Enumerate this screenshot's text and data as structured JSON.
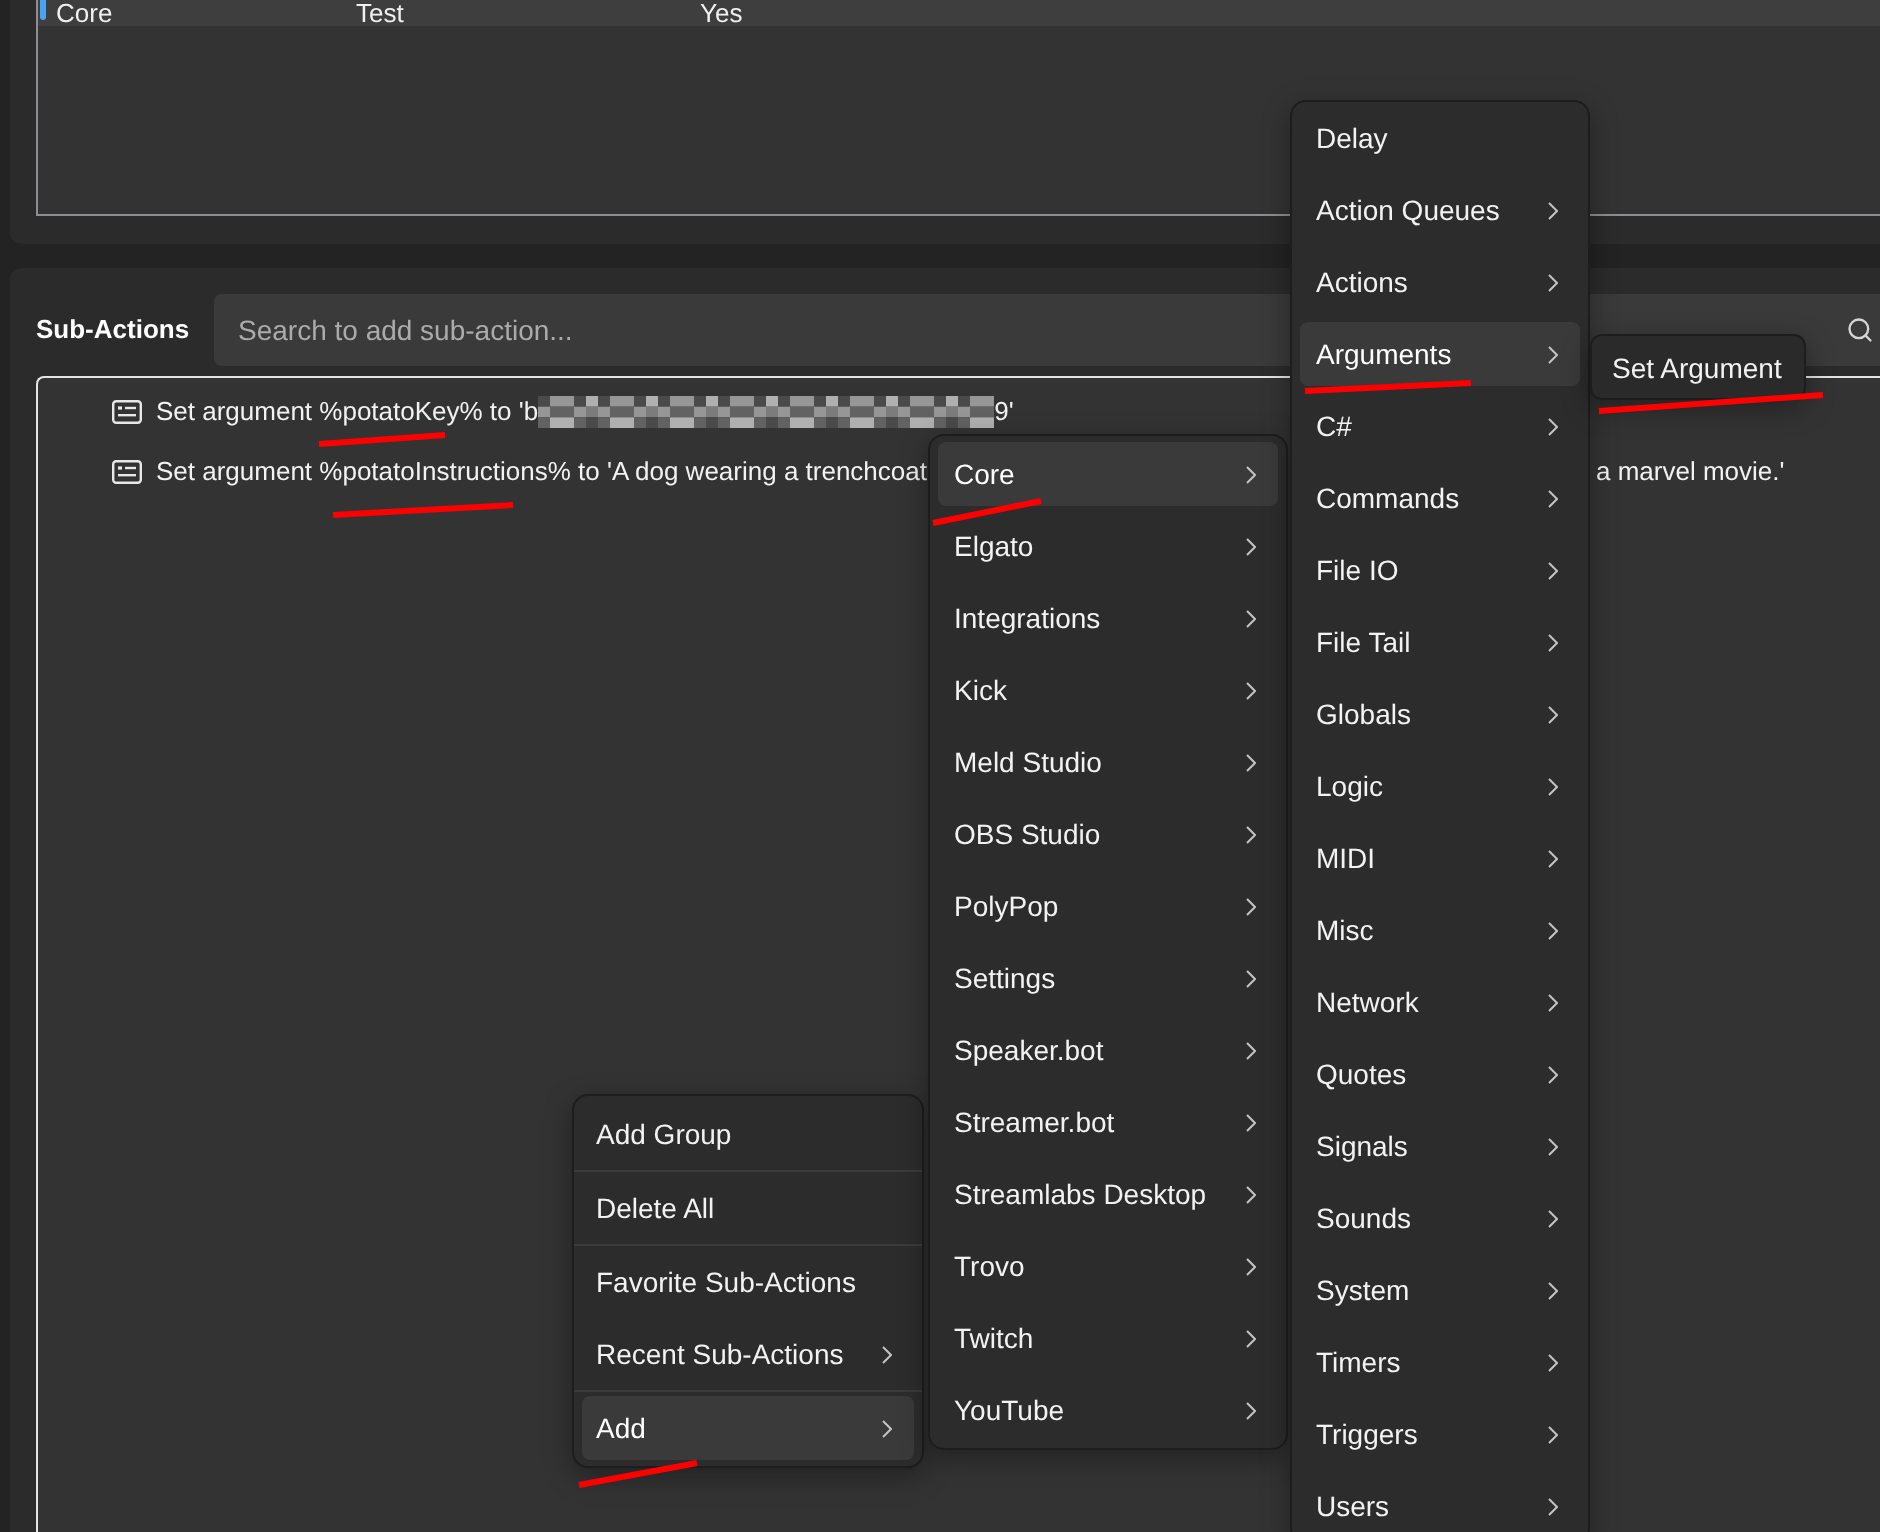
{
  "table": {
    "rows": [
      {
        "cells": [
          "Core",
          "Test",
          "Yes"
        ],
        "selected": true
      }
    ]
  },
  "sub_actions": {
    "label": "Sub-Actions",
    "search": {
      "placeholder": "Search to add sub-action..."
    },
    "items": [
      {
        "kind": "redacted",
        "text": "Set argument %potatoKey% to 'b",
        "text_end": "9'",
        "underlined": true
      },
      {
        "kind": "overlapped",
        "text": "Set argument %potatoInstructions% to 'A dog wearing a trenchcoat",
        "text_end": "a marvel movie.'",
        "underlined": true
      }
    ]
  },
  "context_menu": {
    "groups": [
      {
        "items": [
          {
            "label": "Add Group",
            "submenu": false,
            "selected": false,
            "underlined": false
          }
        ]
      },
      {
        "items": [
          {
            "label": "Delete All",
            "submenu": false,
            "selected": false,
            "underlined": false
          }
        ]
      },
      {
        "items": [
          {
            "label": "Favorite Sub-Actions",
            "submenu": false,
            "selected": false,
            "underlined": false
          },
          {
            "label": "Recent Sub-Actions",
            "submenu": true,
            "selected": false,
            "underlined": false
          }
        ]
      },
      {
        "items": [
          {
            "label": "Add",
            "submenu": true,
            "selected": true,
            "underlined": true
          }
        ]
      }
    ]
  },
  "add_menu": {
    "items": [
      {
        "label": "Core",
        "submenu": true,
        "selected": true,
        "underlined": true
      },
      {
        "label": "Elgato",
        "submenu": true,
        "selected": false,
        "underlined": false
      },
      {
        "label": "Integrations",
        "submenu": true,
        "selected": false,
        "underlined": false
      },
      {
        "label": "Kick",
        "submenu": true,
        "selected": false,
        "underlined": false
      },
      {
        "label": "Meld Studio",
        "submenu": true,
        "selected": false,
        "underlined": false
      },
      {
        "label": "OBS Studio",
        "submenu": true,
        "selected": false,
        "underlined": false
      },
      {
        "label": "PolyPop",
        "submenu": true,
        "selected": false,
        "underlined": false
      },
      {
        "label": "Settings",
        "submenu": true,
        "selected": false,
        "underlined": false
      },
      {
        "label": "Speaker.bot",
        "submenu": true,
        "selected": false,
        "underlined": false
      },
      {
        "label": "Streamer.bot",
        "submenu": true,
        "selected": false,
        "underlined": false
      },
      {
        "label": "Streamlabs Desktop",
        "submenu": true,
        "selected": false,
        "underlined": false
      },
      {
        "label": "Trovo",
        "submenu": true,
        "selected": false,
        "underlined": false
      },
      {
        "label": "Twitch",
        "submenu": true,
        "selected": false,
        "underlined": false
      },
      {
        "label": "YouTube",
        "submenu": true,
        "selected": false,
        "underlined": false
      }
    ]
  },
  "category_menu": {
    "items": [
      {
        "label": "Delay",
        "submenu": false,
        "selected": false,
        "underlined": false
      },
      {
        "label": "Action Queues",
        "submenu": true,
        "selected": false,
        "underlined": false
      },
      {
        "label": "Actions",
        "submenu": true,
        "selected": false,
        "underlined": false
      },
      {
        "label": "Arguments",
        "submenu": true,
        "selected": true,
        "underlined": true
      },
      {
        "label": "C#",
        "submenu": true,
        "selected": false,
        "underlined": false
      },
      {
        "label": "Commands",
        "submenu": true,
        "selected": false,
        "underlined": false
      },
      {
        "label": "File IO",
        "submenu": true,
        "selected": false,
        "underlined": false
      },
      {
        "label": "File Tail",
        "submenu": true,
        "selected": false,
        "underlined": false
      },
      {
        "label": "Globals",
        "submenu": true,
        "selected": false,
        "underlined": false
      },
      {
        "label": "Logic",
        "submenu": true,
        "selected": false,
        "underlined": false
      },
      {
        "label": "MIDI",
        "submenu": true,
        "selected": false,
        "underlined": false
      },
      {
        "label": "Misc",
        "submenu": true,
        "selected": false,
        "underlined": false
      },
      {
        "label": "Network",
        "submenu": true,
        "selected": false,
        "underlined": false
      },
      {
        "label": "Quotes",
        "submenu": true,
        "selected": false,
        "underlined": false
      },
      {
        "label": "Signals",
        "submenu": true,
        "selected": false,
        "underlined": false
      },
      {
        "label": "Sounds",
        "submenu": true,
        "selected": false,
        "underlined": false
      },
      {
        "label": "System",
        "submenu": true,
        "selected": false,
        "underlined": false
      },
      {
        "label": "Timers",
        "submenu": true,
        "selected": false,
        "underlined": false
      },
      {
        "label": "Triggers",
        "submenu": true,
        "selected": false,
        "underlined": false
      },
      {
        "label": "Users",
        "submenu": true,
        "selected": false,
        "underlined": false
      }
    ]
  },
  "arguments_menu": {
    "items": [
      {
        "label": "Set Argument",
        "submenu": false,
        "selected": false,
        "underlined": true
      }
    ]
  }
}
